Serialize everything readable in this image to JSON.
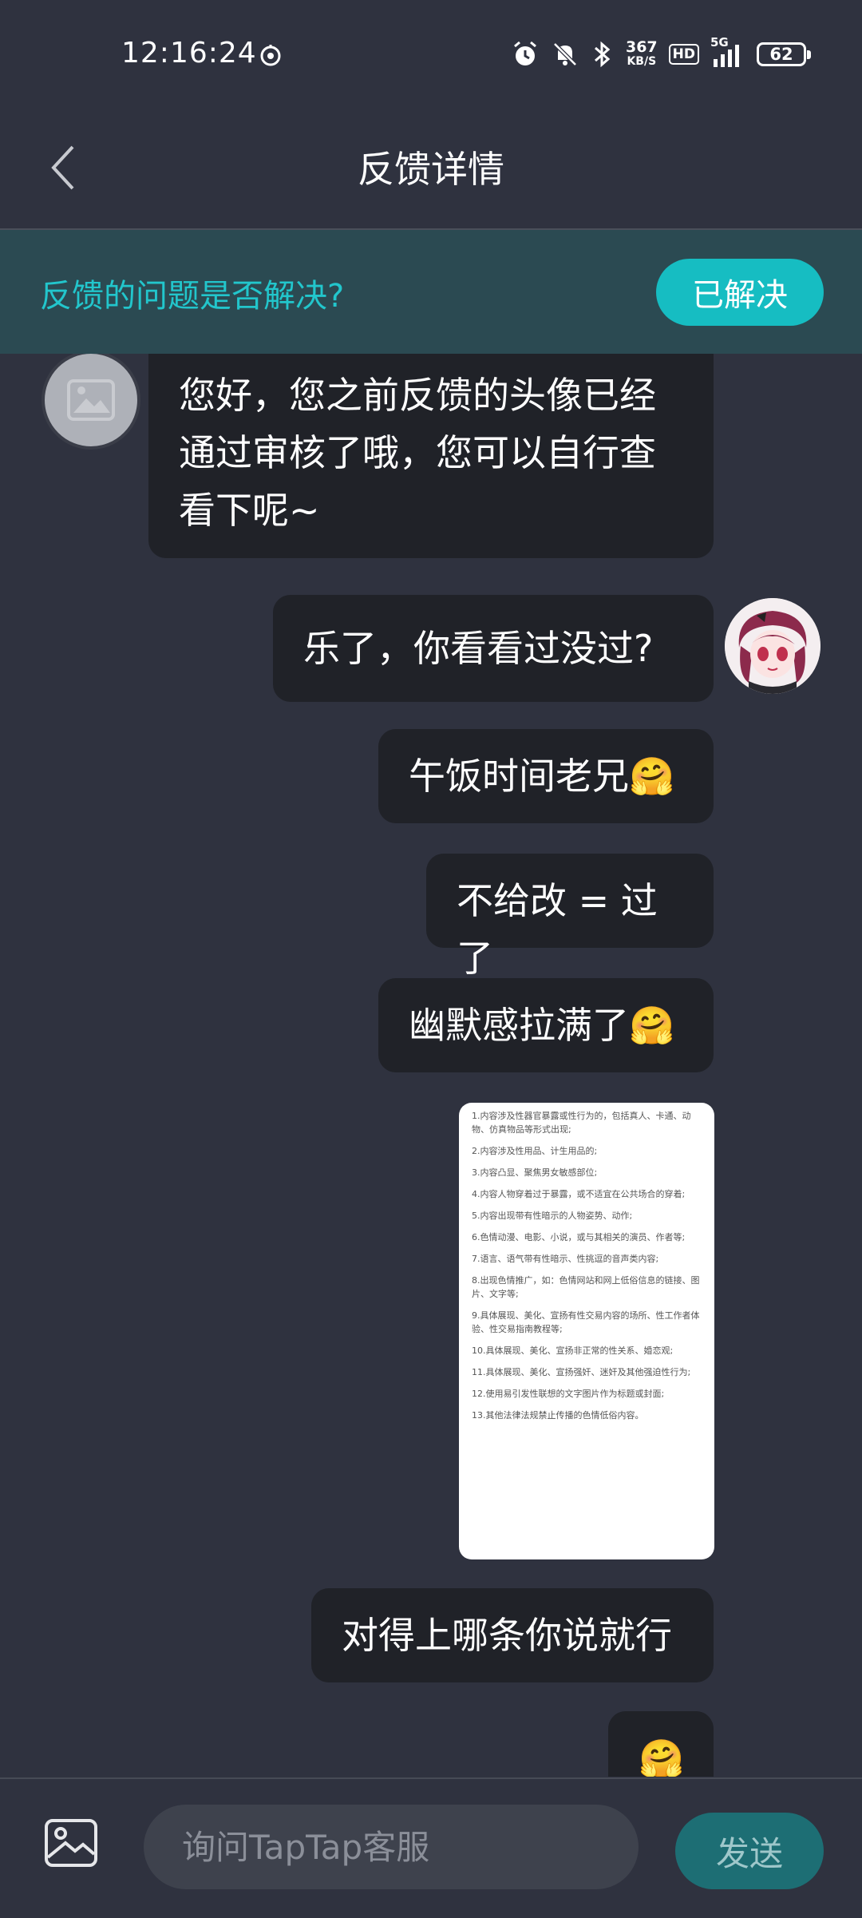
{
  "status_bar": {
    "time": "12:16:24",
    "net_speed_value": "367",
    "net_speed_unit": "KB/S",
    "hd": "HD",
    "network": "5G",
    "battery": "62"
  },
  "header": {
    "title": "反馈详情"
  },
  "banner": {
    "question": "反馈的问题是否解决?",
    "resolved_label": "已解决"
  },
  "messages": [
    {
      "from": "agent",
      "text": "您好，您之前反馈的头像已经通过审核了哦，您可以自行查看下呢~"
    },
    {
      "from": "user",
      "text": "乐了，你看看过没过?"
    },
    {
      "from": "user",
      "text": "午饭时间老兄🤗"
    },
    {
      "from": "user",
      "text": "不给改 = 过了"
    },
    {
      "from": "user",
      "text": "幽默感拉满了🤗"
    },
    {
      "from": "user",
      "type": "image",
      "rules": [
        "1.内容涉及性器官暴露或性行为的，包括真人、卡通、动物、仿真物品等形式出现;",
        "2.内容涉及性用品、计生用品的;",
        "3.内容凸显、聚焦男女敏感部位;",
        "4.内容人物穿着过于暴露，或不适宜在公共场合的穿着;",
        "5.内容出现带有性暗示的人物姿势、动作;",
        "6.色情动漫、电影、小说，或与其相关的演员、作者等;",
        "7.语言、语气带有性暗示、性挑逗的音声类内容;",
        "8.出现色情推广，如：色情网站和网上低俗信息的链接、图片、文字等;",
        "9.具体展现、美化、宣扬有性交易内容的场所、性工作者体验、性交易指南教程等;",
        "10.具体展现、美化、宣扬非正常的性关系、婚恋观;",
        "11.具体展现、美化、宣扬强奸、迷奸及其他强迫性行为;",
        "12.使用易引发性联想的文字图片作为标题或封面;",
        "13.其他法律法规禁止传播的色情低俗内容。"
      ]
    },
    {
      "from": "user",
      "text": "对得上哪条你说就行"
    },
    {
      "from": "user",
      "text": "🤗"
    }
  ],
  "composer": {
    "placeholder": "询问TapTap客服",
    "send_label": "发送"
  },
  "colors": {
    "background": "#2f323f",
    "bubble": "#202228",
    "accent": "#16bdc2",
    "banner": "#2b4a52"
  }
}
